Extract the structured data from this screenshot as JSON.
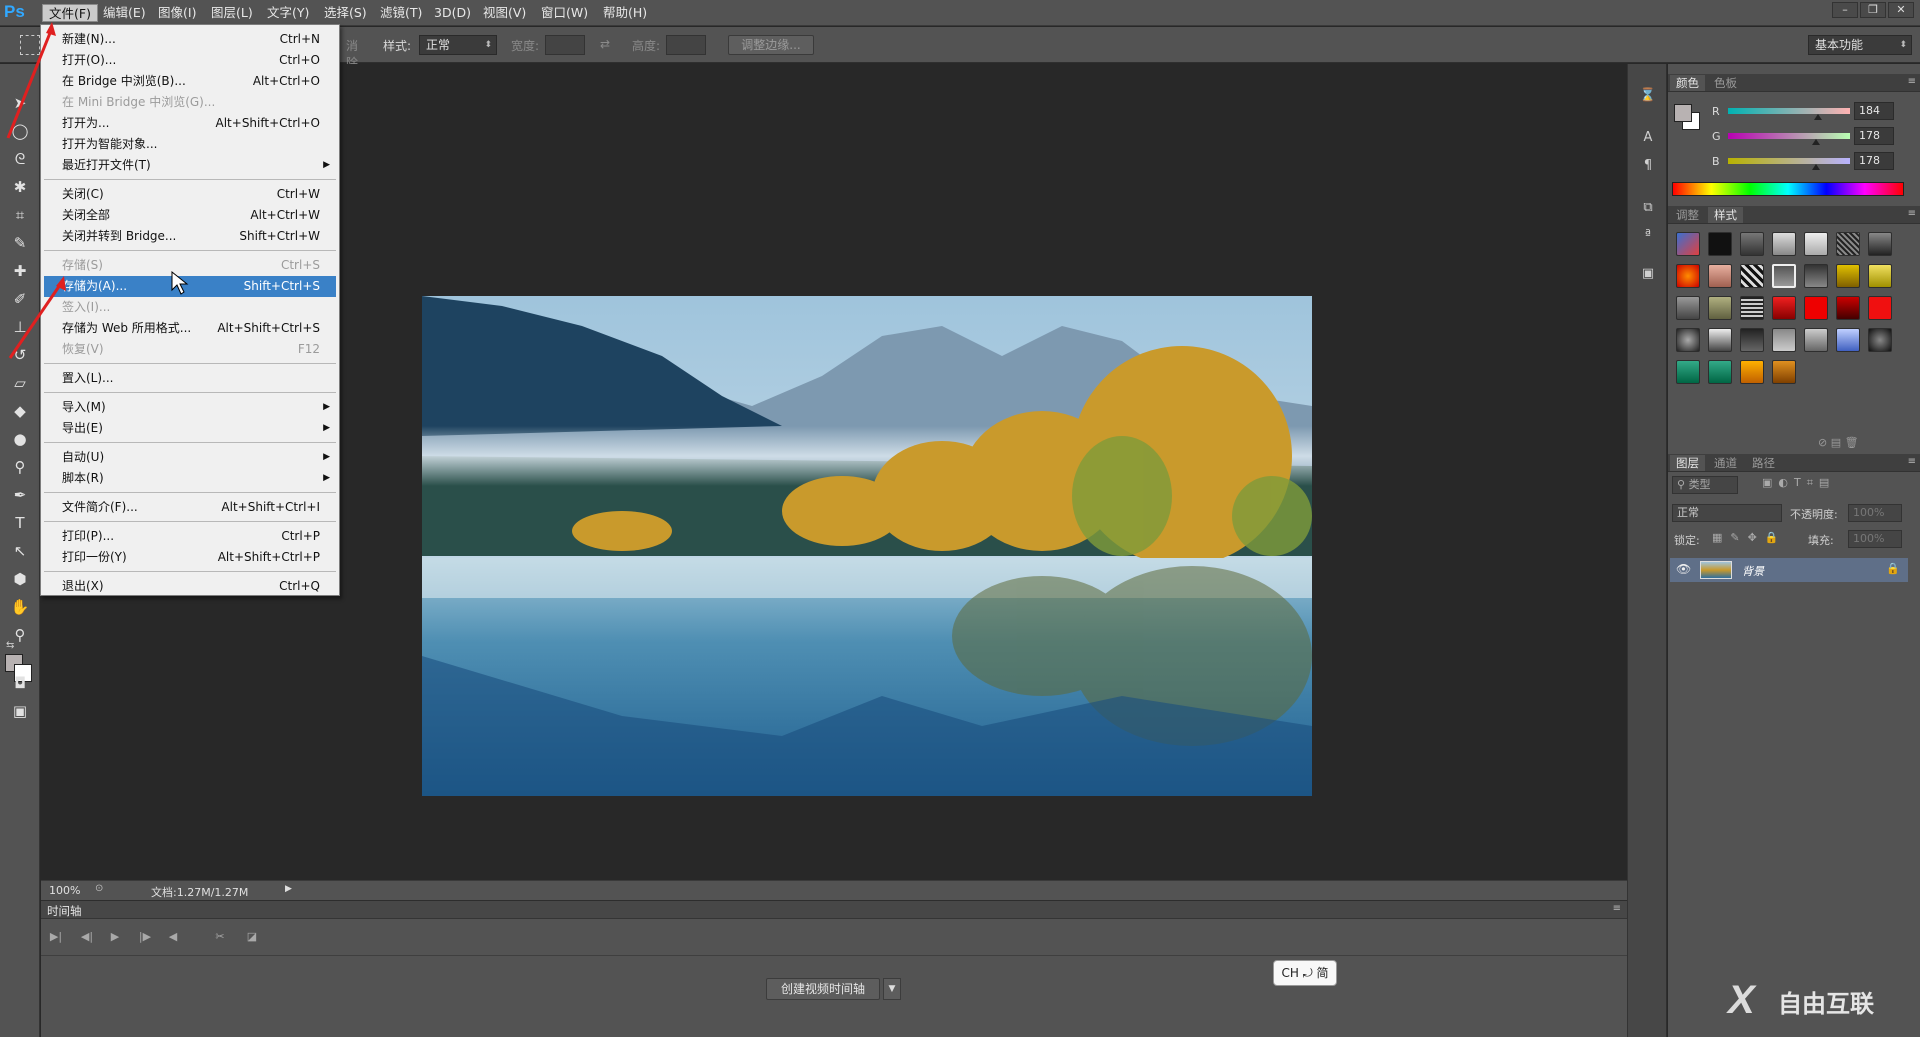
{
  "app": {
    "logo": "Ps"
  },
  "menubar": {
    "items": [
      "文件(F)",
      "编辑(E)",
      "图像(I)",
      "图层(L)",
      "文字(Y)",
      "选择(S)",
      "滤镜(T)",
      "3D(D)",
      "视图(V)",
      "窗口(W)",
      "帮助(H)"
    ],
    "active_index": 0
  },
  "window_controls": [
    "–",
    "❐",
    "✕"
  ],
  "options": {
    "feather_fragment": "消除锯齿",
    "style_label": "样式:",
    "style_value": "正常",
    "width_label": "宽度:",
    "height_label": "高度:",
    "refine_edge": "调整边缘...",
    "workspace": "基本功能"
  },
  "file_menu": {
    "items": [
      {
        "label": "新建(N)...",
        "shortcut": "Ctrl+N"
      },
      {
        "label": "打开(O)...",
        "shortcut": "Ctrl+O"
      },
      {
        "label": "在 Bridge 中浏览(B)...",
        "shortcut": "Alt+Ctrl+O"
      },
      {
        "label": "在 Mini Bridge 中浏览(G)...",
        "shortcut": "",
        "disabled": true
      },
      {
        "label": "打开为...",
        "shortcut": "Alt+Shift+Ctrl+O"
      },
      {
        "label": "打开为智能对象...",
        "shortcut": ""
      },
      {
        "label": "最近打开文件(T)",
        "shortcut": "",
        "submenu": true
      },
      {
        "label": "关闭(C)",
        "shortcut": "Ctrl+W"
      },
      {
        "label": "关闭全部",
        "shortcut": "Alt+Ctrl+W"
      },
      {
        "label": "关闭并转到 Bridge...",
        "shortcut": "Shift+Ctrl+W"
      },
      {
        "label": "存储(S)",
        "shortcut": "Ctrl+S",
        "disabled": true
      },
      {
        "label": "存储为(A)...",
        "shortcut": "Shift+Ctrl+S",
        "highlighted": true
      },
      {
        "label": "签入(I)...",
        "shortcut": "",
        "disabled": true
      },
      {
        "label": "存储为 Web 所用格式...",
        "shortcut": "Alt+Shift+Ctrl+S"
      },
      {
        "label": "恢复(V)",
        "shortcut": "F12",
        "disabled": true
      },
      {
        "label": "置入(L)...",
        "shortcut": ""
      },
      {
        "label": "导入(M)",
        "shortcut": "",
        "submenu": true
      },
      {
        "label": "导出(E)",
        "shortcut": "",
        "submenu": true
      },
      {
        "label": "自动(U)",
        "shortcut": "",
        "submenu": true
      },
      {
        "label": "脚本(R)",
        "shortcut": "",
        "submenu": true
      },
      {
        "label": "文件简介(F)...",
        "shortcut": "Alt+Shift+Ctrl+I"
      },
      {
        "label": "打印(P)...",
        "shortcut": "Ctrl+P"
      },
      {
        "label": "打印一份(Y)",
        "shortcut": "Alt+Shift+Ctrl+P"
      },
      {
        "label": "退出(X)",
        "shortcut": "Ctrl+Q"
      }
    ]
  },
  "status": {
    "zoom": "100%",
    "doc": "文档:1.27M/1.27M"
  },
  "timeline": {
    "tab": "时间轴",
    "create_button": "创建视频时间轴"
  },
  "ime": {
    "text": "CH ⤾ 简"
  },
  "color_panel": {
    "tabs": [
      "颜色",
      "色板"
    ],
    "channels": [
      {
        "name": "R",
        "value": "184"
      },
      {
        "name": "G",
        "value": "178"
      },
      {
        "name": "B",
        "value": "178"
      }
    ]
  },
  "styles_panel": {
    "tabs": [
      "调整",
      "样式"
    ]
  },
  "layers_panel": {
    "tabs": [
      "图层",
      "通道",
      "路径"
    ],
    "filter": "类型",
    "blend_mode": "正常",
    "opacity_label": "不透明度:",
    "opacity_value": "100%",
    "lock_label": "锁定:",
    "fill_label": "填充:",
    "fill_value": "100%",
    "layer_name": "背景"
  },
  "watermark": {
    "text": "自由互联"
  },
  "colors": {
    "accent": "#3a81c7",
    "ps_blue": "#31a8ff",
    "foreground": "#b8b2b2",
    "annotation_arrow": "#e02020"
  }
}
